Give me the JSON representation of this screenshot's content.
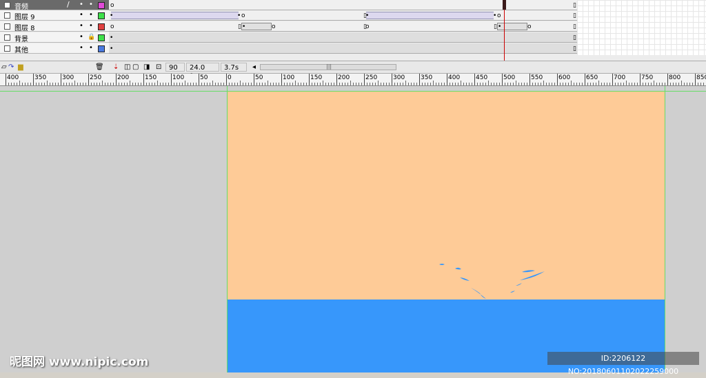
{
  "layers": [
    {
      "name": "音频",
      "color": "#e04ad8",
      "selected": true
    },
    {
      "name": "图层 9",
      "color": "#3ee04a",
      "selected": false
    },
    {
      "name": "图层 8",
      "color": "#e04040",
      "selected": false
    },
    {
      "name": "背景",
      "color": "#3ee04a",
      "selected": false,
      "locked": true
    },
    {
      "name": "其他",
      "color": "#4a7ae0",
      "selected": false
    }
  ],
  "footer": {
    "frame": "90",
    "fps": "24.0 fps",
    "time": "3.7s"
  },
  "ruler": {
    "labels": [
      "400",
      "350",
      "300",
      "250",
      "200",
      "150",
      "100",
      "50",
      "0",
      "50",
      "100",
      "150",
      "200",
      "250",
      "300",
      "350",
      "400",
      "450",
      "500",
      "550",
      "600",
      "650",
      "700",
      "750",
      "800",
      "850"
    ]
  },
  "colors": {
    "stage_bg": "#fecb97",
    "sea": "#3797fb",
    "workspace": "#cfcfcf",
    "playhead": "#cc0000"
  },
  "watermark": {
    "logo": "昵图网 www.nipic.com",
    "id": "ID:2206122 NO:20180601102022259000"
  }
}
